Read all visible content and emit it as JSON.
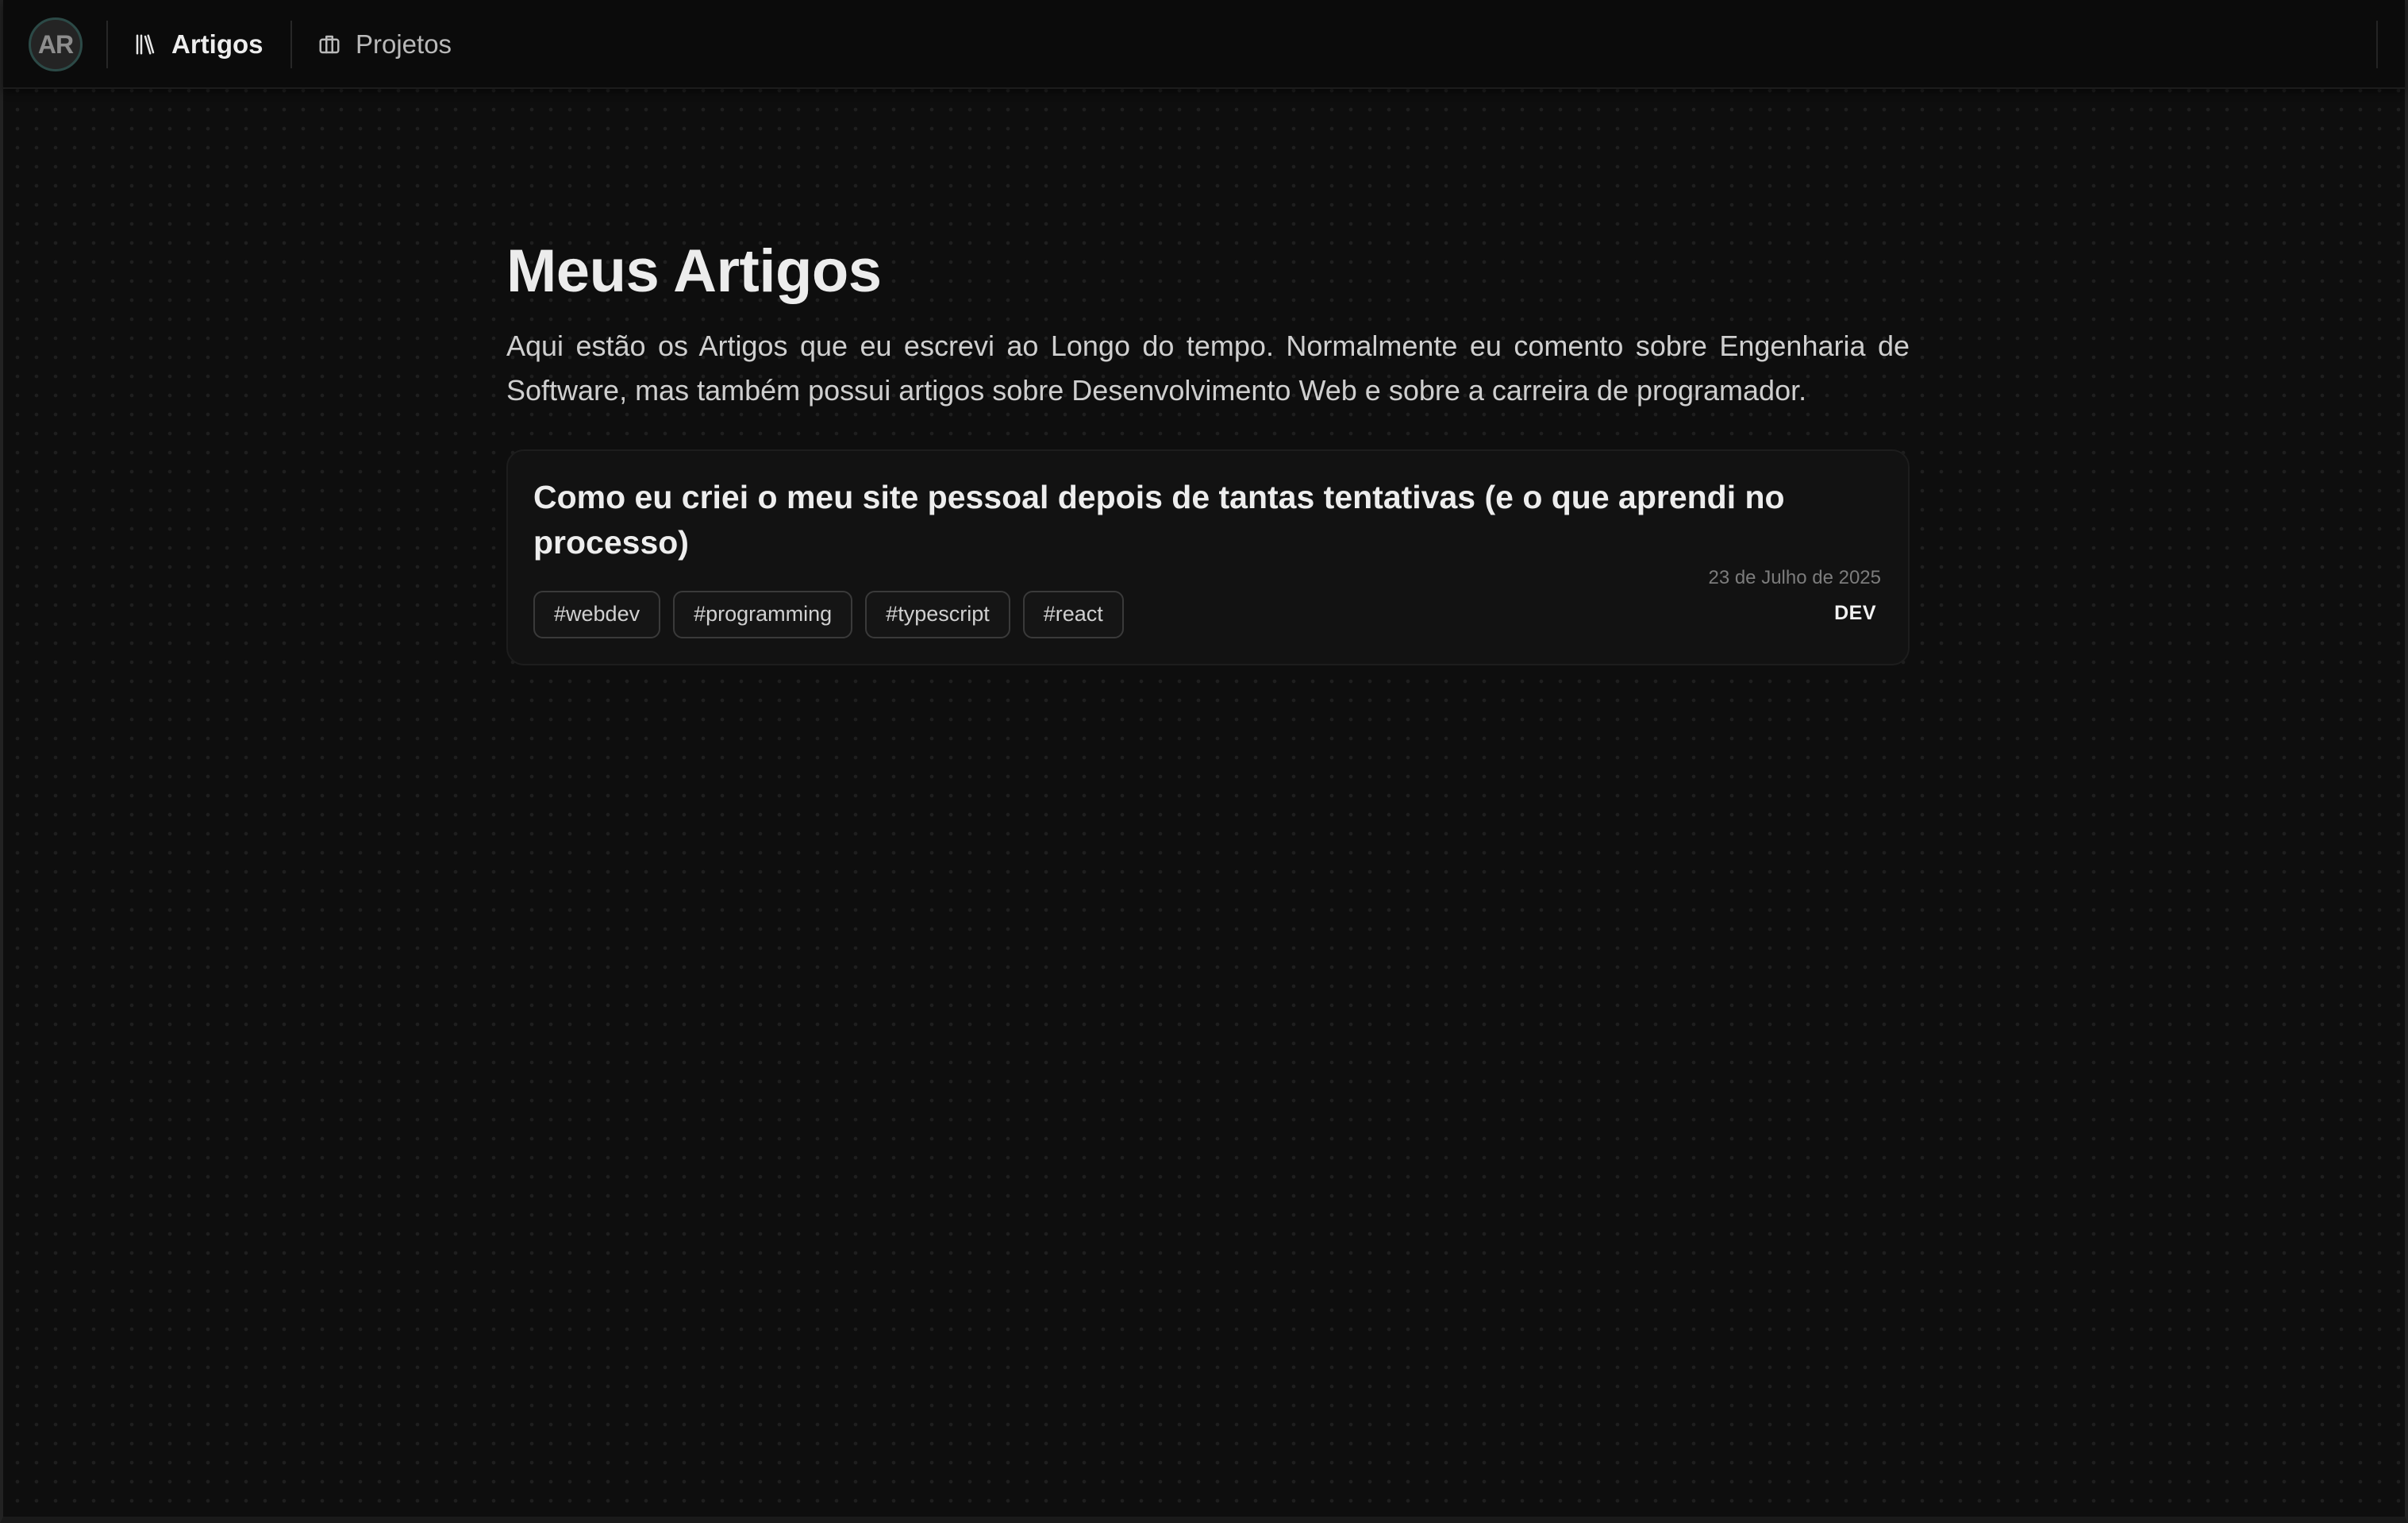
{
  "nav": {
    "avatar_initials": "AR",
    "items": [
      {
        "label": "Artigos",
        "icon": "library-icon",
        "active": true
      },
      {
        "label": "Projetos",
        "icon": "briefcase-icon",
        "active": false
      }
    ]
  },
  "page": {
    "title": "Meus Artigos",
    "description": "Aqui estão os Artigos que eu escrevi ao Longo do tempo. Normalmente eu comento sobre Engenharia de Software, mas também possui artigos sobre Desenvolvimento Web e sobre a carreira de programador."
  },
  "articles": [
    {
      "title": "Como eu criei o meu site pessoal depois de tantas tentativas (e o que aprendi no processo)",
      "tags": [
        "#webdev",
        "#programming",
        "#typescript",
        "#react"
      ],
      "date": "23 de Julho de 2025",
      "source": "DEV"
    }
  ],
  "colors": {
    "background": "#0e0e0e",
    "avatar_ring": "#2c4a47",
    "card": "#121212"
  }
}
